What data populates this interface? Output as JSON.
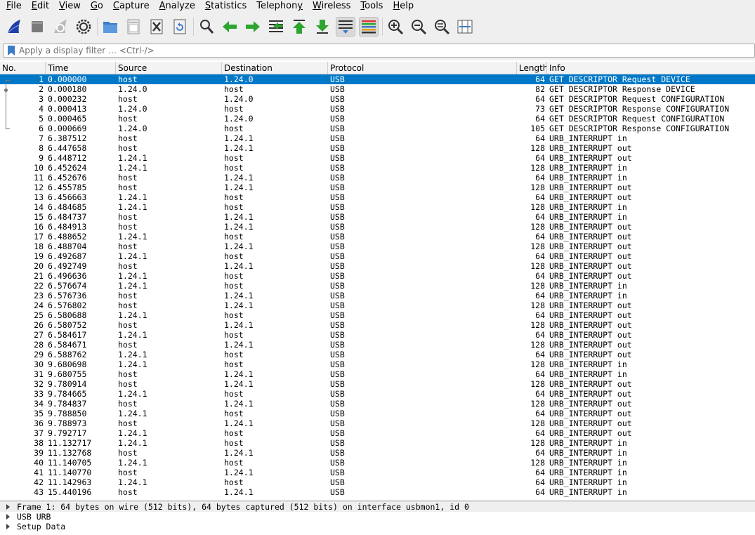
{
  "menu": [
    {
      "u": "F",
      "rest": "ile"
    },
    {
      "u": "E",
      "rest": "dit"
    },
    {
      "u": "V",
      "rest": "iew"
    },
    {
      "u": "G",
      "rest": "o"
    },
    {
      "u": "C",
      "rest": "apture"
    },
    {
      "u": "A",
      "rest": "nalyze"
    },
    {
      "u": "S",
      "rest": "tatistics"
    },
    {
      "u": "",
      "pre": "Telephon",
      "u2": "y",
      "rest": ""
    },
    {
      "u": "W",
      "rest": "ireless"
    },
    {
      "u": "T",
      "rest": "ools"
    },
    {
      "u": "H",
      "rest": "elp"
    }
  ],
  "filter": {
    "placeholder": "Apply a display filter … <Ctrl-/>",
    "value": ""
  },
  "columns": {
    "no": "No.",
    "time": "Time",
    "source": "Source",
    "destination": "Destination",
    "protocol": "Protocol",
    "length": "Length",
    "info": "Info"
  },
  "packets": [
    [
      "1",
      "0.000000",
      "host",
      "1.24.0",
      "USB",
      "64",
      "GET DESCRIPTOR Request DEVICE"
    ],
    [
      "2",
      "0.000180",
      "1.24.0",
      "host",
      "USB",
      "82",
      "GET DESCRIPTOR Response DEVICE"
    ],
    [
      "3",
      "0.000232",
      "host",
      "1.24.0",
      "USB",
      "64",
      "GET DESCRIPTOR Request CONFIGURATION"
    ],
    [
      "4",
      "0.000413",
      "1.24.0",
      "host",
      "USB",
      "73",
      "GET DESCRIPTOR Response CONFIGURATION"
    ],
    [
      "5",
      "0.000465",
      "host",
      "1.24.0",
      "USB",
      "64",
      "GET DESCRIPTOR Request CONFIGURATION"
    ],
    [
      "6",
      "0.000669",
      "1.24.0",
      "host",
      "USB",
      "105",
      "GET DESCRIPTOR Response CONFIGURATION"
    ],
    [
      "7",
      "6.387512",
      "host",
      "1.24.1",
      "USB",
      "64",
      "URB_INTERRUPT in"
    ],
    [
      "8",
      "6.447658",
      "host",
      "1.24.1",
      "USB",
      "128",
      "URB_INTERRUPT out"
    ],
    [
      "9",
      "6.448712",
      "1.24.1",
      "host",
      "USB",
      "64",
      "URB_INTERRUPT out"
    ],
    [
      "10",
      "6.452624",
      "1.24.1",
      "host",
      "USB",
      "128",
      "URB_INTERRUPT in"
    ],
    [
      "11",
      "6.452676",
      "host",
      "1.24.1",
      "USB",
      "64",
      "URB_INTERRUPT in"
    ],
    [
      "12",
      "6.455785",
      "host",
      "1.24.1",
      "USB",
      "128",
      "URB_INTERRUPT out"
    ],
    [
      "13",
      "6.456663",
      "1.24.1",
      "host",
      "USB",
      "64",
      "URB_INTERRUPT out"
    ],
    [
      "14",
      "6.484685",
      "1.24.1",
      "host",
      "USB",
      "128",
      "URB_INTERRUPT in"
    ],
    [
      "15",
      "6.484737",
      "host",
      "1.24.1",
      "USB",
      "64",
      "URB_INTERRUPT in"
    ],
    [
      "16",
      "6.484913",
      "host",
      "1.24.1",
      "USB",
      "128",
      "URB_INTERRUPT out"
    ],
    [
      "17",
      "6.488652",
      "1.24.1",
      "host",
      "USB",
      "64",
      "URB_INTERRUPT out"
    ],
    [
      "18",
      "6.488704",
      "host",
      "1.24.1",
      "USB",
      "128",
      "URB_INTERRUPT out"
    ],
    [
      "19",
      "6.492687",
      "1.24.1",
      "host",
      "USB",
      "64",
      "URB_INTERRUPT out"
    ],
    [
      "20",
      "6.492749",
      "host",
      "1.24.1",
      "USB",
      "128",
      "URB_INTERRUPT out"
    ],
    [
      "21",
      "6.496636",
      "1.24.1",
      "host",
      "USB",
      "64",
      "URB_INTERRUPT out"
    ],
    [
      "22",
      "6.576674",
      "1.24.1",
      "host",
      "USB",
      "128",
      "URB_INTERRUPT in"
    ],
    [
      "23",
      "6.576736",
      "host",
      "1.24.1",
      "USB",
      "64",
      "URB_INTERRUPT in"
    ],
    [
      "24",
      "6.576802",
      "host",
      "1.24.1",
      "USB",
      "128",
      "URB_INTERRUPT out"
    ],
    [
      "25",
      "6.580688",
      "1.24.1",
      "host",
      "USB",
      "64",
      "URB_INTERRUPT out"
    ],
    [
      "26",
      "6.580752",
      "host",
      "1.24.1",
      "USB",
      "128",
      "URB_INTERRUPT out"
    ],
    [
      "27",
      "6.584617",
      "1.24.1",
      "host",
      "USB",
      "64",
      "URB_INTERRUPT out"
    ],
    [
      "28",
      "6.584671",
      "host",
      "1.24.1",
      "USB",
      "128",
      "URB_INTERRUPT out"
    ],
    [
      "29",
      "6.588762",
      "1.24.1",
      "host",
      "USB",
      "64",
      "URB_INTERRUPT out"
    ],
    [
      "30",
      "9.680698",
      "1.24.1",
      "host",
      "USB",
      "128",
      "URB_INTERRUPT in"
    ],
    [
      "31",
      "9.680755",
      "host",
      "1.24.1",
      "USB",
      "64",
      "URB_INTERRUPT in"
    ],
    [
      "32",
      "9.780914",
      "host",
      "1.24.1",
      "USB",
      "128",
      "URB_INTERRUPT out"
    ],
    [
      "33",
      "9.784665",
      "1.24.1",
      "host",
      "USB",
      "64",
      "URB_INTERRUPT out"
    ],
    [
      "34",
      "9.784837",
      "host",
      "1.24.1",
      "USB",
      "128",
      "URB_INTERRUPT out"
    ],
    [
      "35",
      "9.788850",
      "1.24.1",
      "host",
      "USB",
      "64",
      "URB_INTERRUPT out"
    ],
    [
      "36",
      "9.788973",
      "host",
      "1.24.1",
      "USB",
      "128",
      "URB_INTERRUPT out"
    ],
    [
      "37",
      "9.792717",
      "1.24.1",
      "host",
      "USB",
      "64",
      "URB_INTERRUPT out"
    ],
    [
      "38",
      "11.132717",
      "1.24.1",
      "host",
      "USB",
      "128",
      "URB_INTERRUPT in"
    ],
    [
      "39",
      "11.132768",
      "host",
      "1.24.1",
      "USB",
      "64",
      "URB_INTERRUPT in"
    ],
    [
      "40",
      "11.140705",
      "1.24.1",
      "host",
      "USB",
      "128",
      "URB_INTERRUPT in"
    ],
    [
      "41",
      "11.140770",
      "host",
      "1.24.1",
      "USB",
      "64",
      "URB_INTERRUPT in"
    ],
    [
      "42",
      "11.142963",
      "1.24.1",
      "host",
      "USB",
      "64",
      "URB_INTERRUPT in"
    ],
    [
      "43",
      "15.440196",
      "host",
      "1.24.1",
      "USB",
      "64",
      "URB_INTERRUPT in"
    ]
  ],
  "selected_packet": "1",
  "details": [
    "Frame 1: 64 bytes on wire (512 bits), 64 bytes captured (512 bits) on interface usbmon1, id 0",
    "USB URB",
    "Setup Data"
  ],
  "icons": {
    "toolbar": [
      "start-capture-icon",
      "stop-capture-icon",
      "restart-capture-icon",
      "capture-options-icon",
      "open-file-icon",
      "save-file-icon",
      "close-file-icon",
      "reload-file-icon",
      "find-packet-icon",
      "go-back-icon",
      "go-forward-icon",
      "go-to-packet-icon",
      "go-first-icon",
      "go-last-icon",
      "auto-scroll-icon",
      "colorize-icon",
      "zoom-in-icon",
      "zoom-out-icon",
      "zoom-normal-icon",
      "resize-columns-icon"
    ]
  },
  "colors": {
    "selected_row": "#0078c7",
    "fin_blue": "#1e3fa8",
    "arrow_green": "#2ea52e"
  }
}
